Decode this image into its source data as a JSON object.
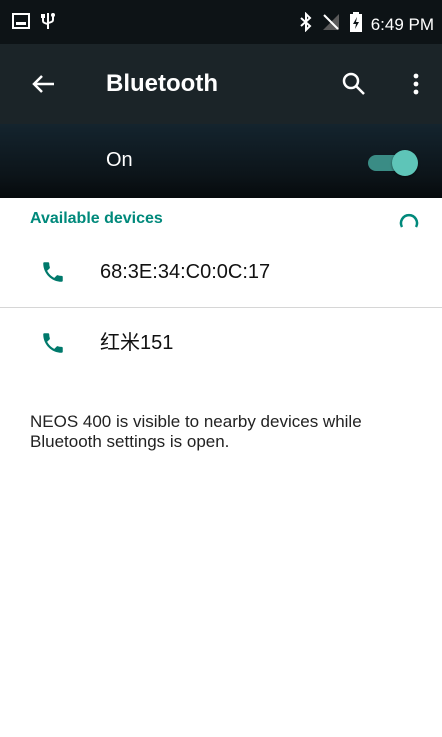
{
  "status_bar": {
    "time": "6:49 PM",
    "icons": [
      "screenshot-icon",
      "usb-icon",
      "bluetooth-icon",
      "no-signal-icon",
      "battery-charging-icon"
    ]
  },
  "app_bar": {
    "title": "Bluetooth",
    "icons": [
      "back-arrow-icon",
      "search-icon",
      "more-vert-icon"
    ]
  },
  "master_switch": {
    "label": "On",
    "state": true
  },
  "available_devices": {
    "header": "Available devices",
    "devices": [
      {
        "name": "68:3E:34:C0:0C:17",
        "icon": "phone-icon"
      },
      {
        "name": "红米151",
        "icon": "phone-icon"
      }
    ]
  },
  "footer_note": "NEOS 400 is visible to nearby devices while Bluetooth settings is open.",
  "colors": {
    "accent": "#00897b",
    "toggle_thumb": "#5ec5b8",
    "toggle_track": "#3a8c85",
    "app_bar": "#1b2428",
    "status_bar": "#0d1316"
  }
}
